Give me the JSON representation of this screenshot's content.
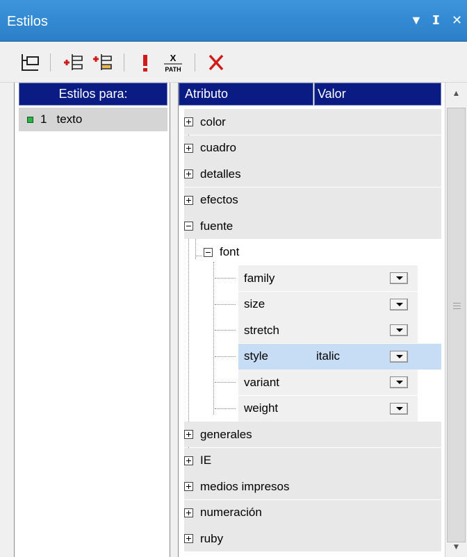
{
  "window": {
    "title": "Estilos",
    "controls": [
      "▼",
      "ᵖ",
      "✕"
    ]
  },
  "toolbar": {
    "buttons": [
      {
        "icon": "tree-layout-icon"
      },
      {
        "icon": "insert-rule-icon"
      },
      {
        "icon": "append-rule-icon"
      },
      {
        "icon": "exclamation-icon",
        "label": "!"
      },
      {
        "icon": "xpath-icon",
        "label_top": "X",
        "label_bottom": "PATH"
      },
      {
        "icon": "delete-icon",
        "label": "✕"
      }
    ]
  },
  "left_panel": {
    "header": "Estilos para:",
    "items": [
      {
        "index": "1",
        "label": "texto"
      }
    ]
  },
  "right_panel": {
    "columns": {
      "attribute": "Atributo",
      "value": "Valor"
    },
    "groups_before": [
      "color",
      "cuadro",
      "detalles",
      "efectos"
    ],
    "expanded_group": "fuente",
    "expanded_sub": "font",
    "properties": [
      {
        "name": "family",
        "value": ""
      },
      {
        "name": "size",
        "value": ""
      },
      {
        "name": "stretch",
        "value": ""
      },
      {
        "name": "style",
        "value": "italic",
        "selected": true
      },
      {
        "name": "variant",
        "value": ""
      },
      {
        "name": "weight",
        "value": ""
      }
    ],
    "groups_after": [
      "generales",
      "IE",
      "medios impresos",
      "numeración",
      "ruby"
    ]
  },
  "colors": {
    "titlebar": "#2b7fc8",
    "header": "#0a1b84",
    "selected_row": "#c6ddf5",
    "delete_red": "#d11a1a"
  }
}
